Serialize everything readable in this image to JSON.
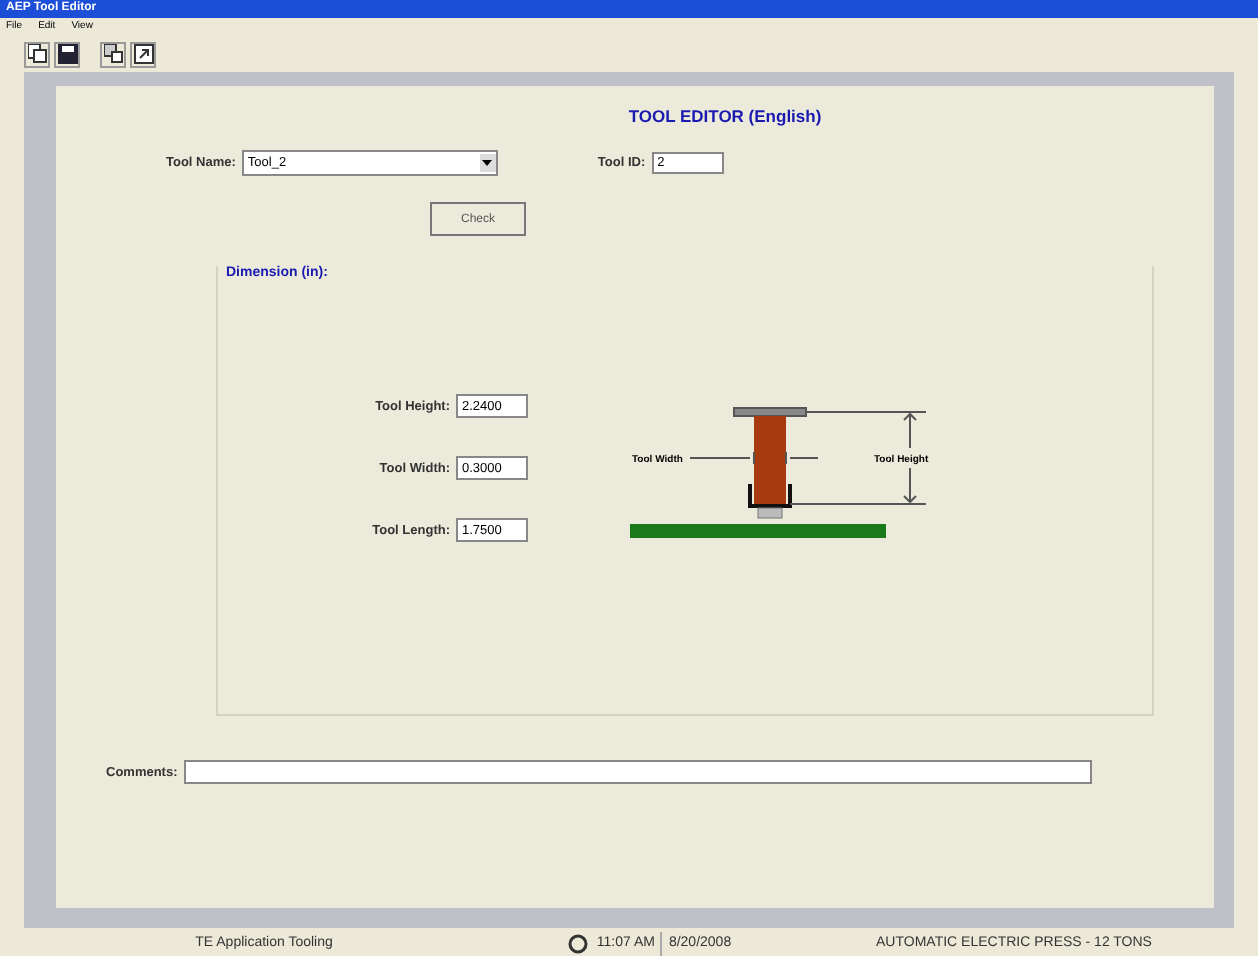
{
  "window": {
    "title": "AEP Tool Editor"
  },
  "menu": [
    "File",
    "Edit",
    "View"
  ],
  "form": {
    "heading": "TOOL EDITOR (English)",
    "tool_name_label": "Tool Name:",
    "tool_name": "Tool_2",
    "tool_id_label": "Tool ID:",
    "tool_id": "2",
    "check_button": "Check"
  },
  "dimensions": {
    "title": "Dimension (in):",
    "fields": [
      {
        "label": "Tool Height:",
        "value": "2.2400"
      },
      {
        "label": "Tool Width:",
        "value": "0.3000"
      },
      {
        "label": "Tool Length:",
        "value": "1.7500"
      }
    ],
    "diagram": {
      "width_label": "Tool Width",
      "height_label": "Tool Height"
    }
  },
  "comments": {
    "label": "Comments:"
  },
  "status_bar": {
    "app": "TE Application Tooling",
    "time": "11:07 AM",
    "date": "8/20/2008",
    "machine": "AUTOMATIC ELECTRIC PRESS - 12 TONS"
  }
}
